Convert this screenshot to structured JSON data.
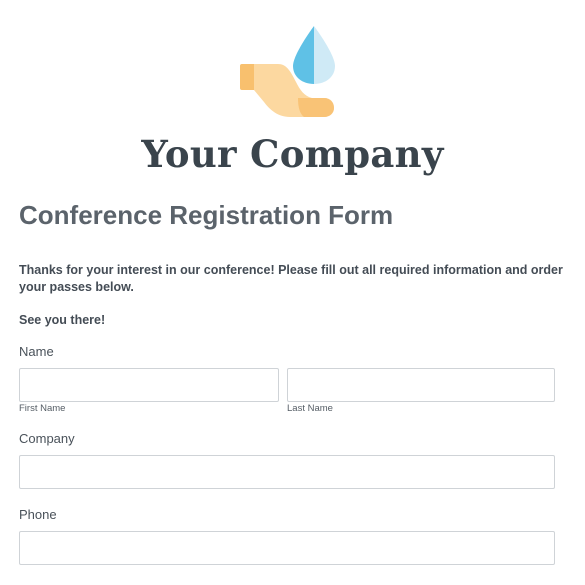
{
  "header": {
    "logo_icon": "hand-water-drop-icon",
    "company_name": "Your Company"
  },
  "form": {
    "title": "Conference Registration Form",
    "intro_text": "Thanks for your interest in our conference! Please fill out all required information and order your passes below.",
    "closing_text": "See you there!",
    "fields": {
      "name": {
        "label": "Name",
        "first_sublabel": "First Name",
        "first_value": "",
        "last_sublabel": "Last Name",
        "last_value": ""
      },
      "company": {
        "label": "Company",
        "value": ""
      },
      "phone": {
        "label": "Phone",
        "value": ""
      }
    }
  },
  "colors": {
    "hand_light": "#fcd8a0",
    "hand_dark": "#f8c06e",
    "drop_light": "#cfeaf6",
    "drop_dark": "#5fc1e6",
    "text_dark": "#3a444c",
    "input_border": "#cfd3d7"
  }
}
